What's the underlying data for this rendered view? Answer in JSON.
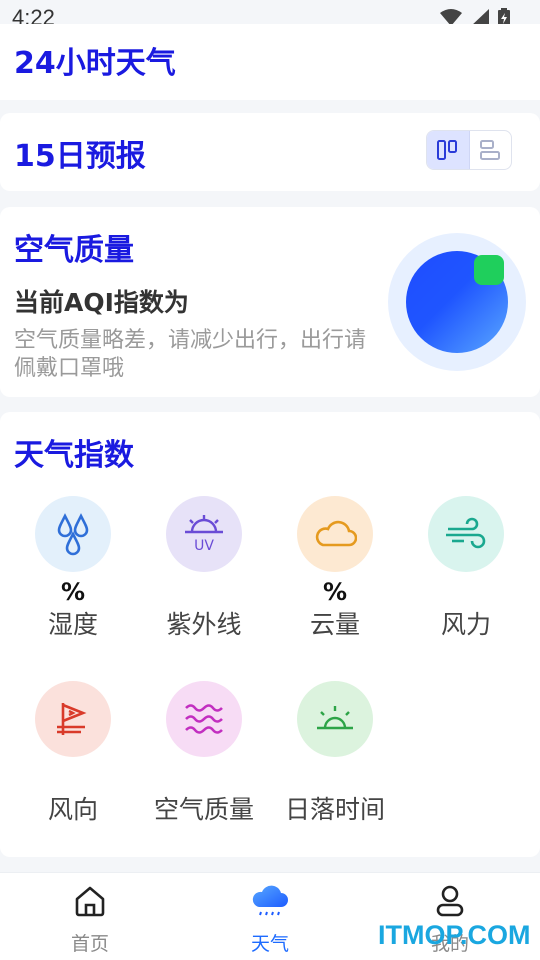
{
  "status_bar": {
    "time": "4:22"
  },
  "hourly": {
    "title": "24小时天气"
  },
  "forecast": {
    "title": "15日预报"
  },
  "air_quality": {
    "title": "空气质量",
    "aqi_label": "当前AQI指数为",
    "description": "空气质量略差，请减少出行，出行请佩戴口罩哦",
    "colors": {
      "ball": "#1f4dff",
      "indicator": "#1fcf5c"
    }
  },
  "weather_index": {
    "title": "天气指数",
    "items": [
      {
        "label": "湿度",
        "value": "%",
        "icon": "droplets-icon",
        "bg": "#e3f0fb"
      },
      {
        "label": "紫外线",
        "value": "",
        "icon": "uv-icon",
        "bg": "#e7e2f8"
      },
      {
        "label": "云量",
        "value": "%",
        "icon": "cloud-icon",
        "bg": "#fde9d2"
      },
      {
        "label": "风力",
        "value": "",
        "icon": "wind-icon",
        "bg": "#d9f4ee"
      },
      {
        "label": "风向",
        "value": "",
        "icon": "wind-direction-icon",
        "bg": "#fbe1dc"
      },
      {
        "label": "空气质量",
        "value": "",
        "icon": "air-waves-icon",
        "bg": "#f7dcf5"
      },
      {
        "label": "日落时间",
        "value": "",
        "icon": "sunset-icon",
        "bg": "#dcf3de"
      }
    ]
  },
  "tabbar": {
    "tabs": [
      {
        "label": "首页",
        "icon": "home-icon"
      },
      {
        "label": "天气",
        "icon": "weather-cloud-icon"
      },
      {
        "label": "我的",
        "icon": "user-icon"
      }
    ],
    "active_color": "#1d6bff"
  },
  "watermark": "ITMOP.COM"
}
